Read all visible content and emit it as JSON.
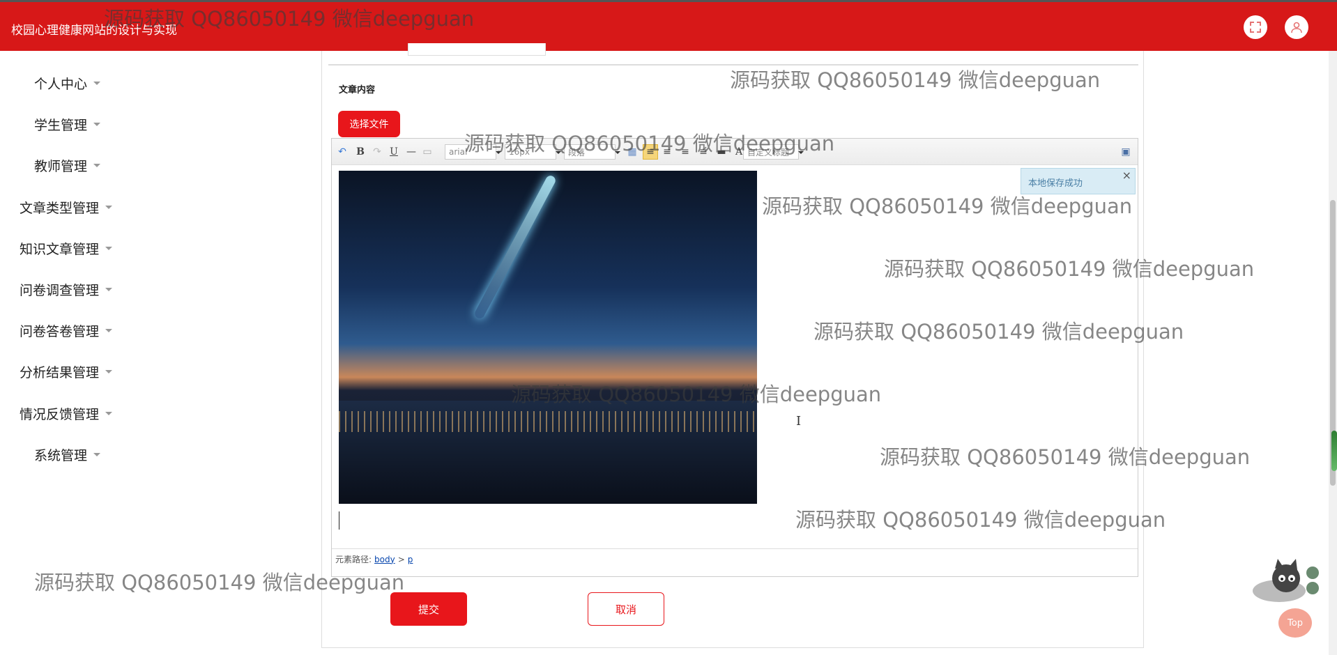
{
  "header": {
    "title": "校园心理健康网站的设计与实现",
    "icons": [
      "fullscreen-icon",
      "user-icon"
    ]
  },
  "sidebar": {
    "items": [
      {
        "label": "个人中心",
        "icon": "chevron-down-icon"
      },
      {
        "label": "学生管理",
        "icon": "chevron-down-icon"
      },
      {
        "label": "教师管理",
        "icon": "chevron-down-icon"
      },
      {
        "label": "文章类型管理",
        "icon": "chevron-down-icon"
      },
      {
        "label": "知识文章管理",
        "icon": "chevron-down-icon"
      },
      {
        "label": "问卷调查管理",
        "icon": "chevron-down-icon"
      },
      {
        "label": "问卷答卷管理",
        "icon": "chevron-down-icon"
      },
      {
        "label": "分析结果管理",
        "icon": "chevron-down-icon"
      },
      {
        "label": "情况反馈管理",
        "icon": "chevron-down-icon"
      },
      {
        "label": "系统管理",
        "icon": "chevron-down-icon"
      }
    ]
  },
  "form": {
    "content_label": "文章内容",
    "choose_file_label": "选择文件",
    "submit_label": "提交",
    "cancel_label": "取消"
  },
  "editor": {
    "toolbar": {
      "font_family": "arial",
      "font_size": "16px",
      "paragraph": "段落",
      "custom_heading": "自定义标题"
    },
    "status": {
      "path_label": "元素路径:",
      "path_body": "body",
      "path_sep": ">",
      "path_p": "p"
    },
    "toast": "本地保存成功"
  },
  "watermark": "源码获取 QQ86050149 微信deepguan",
  "top_button": "Top",
  "colors": {
    "brand": "#d71818",
    "button": "#e8161b"
  }
}
